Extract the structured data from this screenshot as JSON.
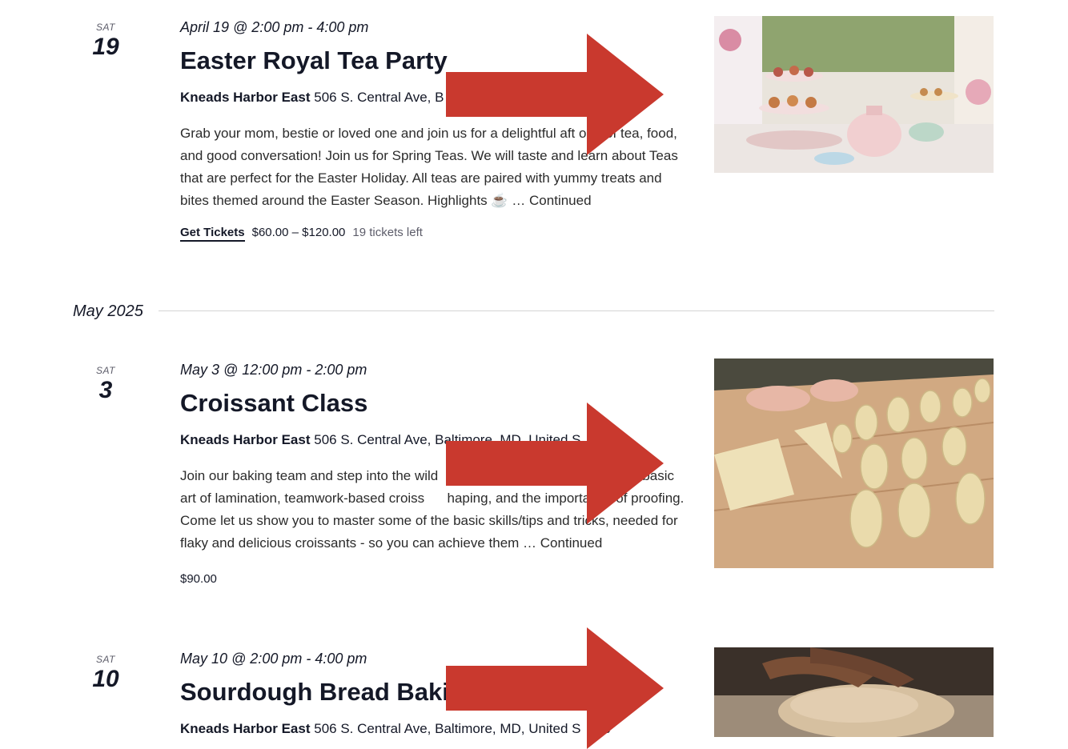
{
  "events": [
    {
      "dow": "SAT",
      "day": "19",
      "datetime": "April 19 @ 2:00 pm - 4:00 pm",
      "title": "Easter Royal Tea Party",
      "venue_name": "Kneads Harbor East",
      "venue_address": "506 S. Central Ave, B",
      "description": "Grab your mom, bestie or loved one and join us for a delightful aft   oon of tea, food, and good conversation! Join us for Spring Teas. We will taste and learn about Teas that are perfect for the Easter Holiday. All teas are paired with yummy treats and bites themed around the Easter Season.  Highlights ☕ …",
      "continued": "Continued",
      "tickets_label": "Get Tickets",
      "price": "$60.00 – $120.00",
      "tickets_left": "19 tickets left"
    },
    {
      "dow": "SAT",
      "day": "3",
      "datetime": "May 3 @ 12:00 pm - 2:00 pm",
      "title": "Croissant Class",
      "venue_name": "Kneads Harbor East",
      "venue_address": "506 S. Central Ave, Baltimore, MD, United S",
      "description": "Join our baking team and step into the wild                     n from our chefs the basic art of lamination, teamwork-based croiss      haping, and the importance of proofing. Come let us show you to master some of the basic skills/tips and tricks, needed for flaky and delicious croissants - so you can achieve them …",
      "continued": "Continued",
      "price": "$90.00"
    },
    {
      "dow": "SAT",
      "day": "10",
      "datetime": "May 10 @ 2:00 pm - 4:00 pm",
      "title": "Sourdough Bread Bakin",
      "venue_name": "Kneads Harbor East",
      "venue_address": "506 S. Central Ave, Baltimore, MD, United S    es"
    }
  ],
  "month_separator": "May 2025",
  "colors": {
    "arrow": "#c9392e",
    "text": "#141827",
    "muted": "#5d5d6a",
    "divider": "#d5d5d5"
  }
}
